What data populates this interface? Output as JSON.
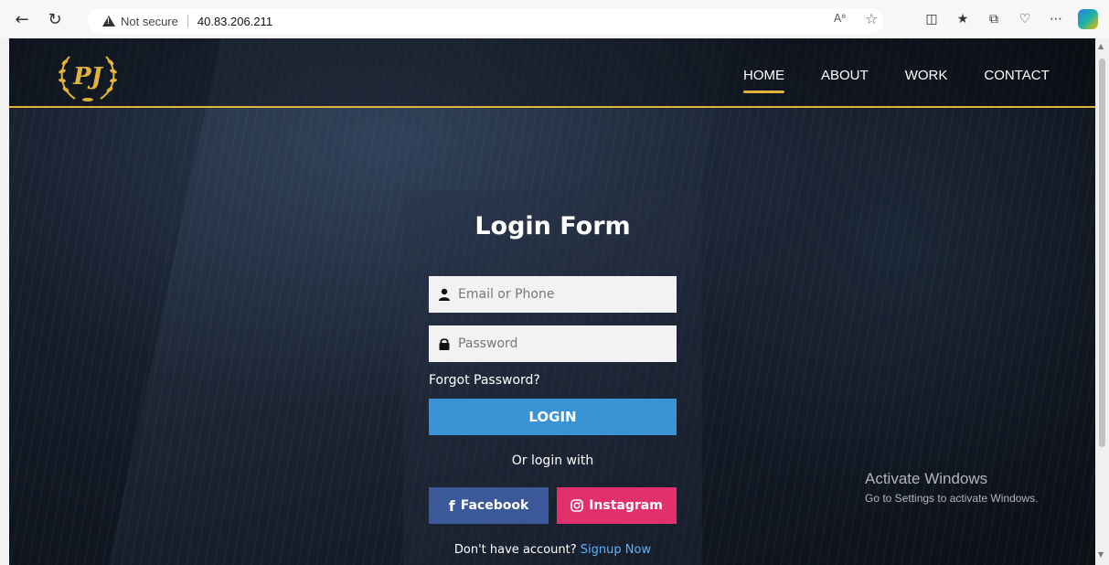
{
  "browser": {
    "security_label": "Not secure",
    "url": "40.83.206.211",
    "icons": [
      "back-icon",
      "reload-icon",
      "warning-icon",
      "read-aloud-icon",
      "favorite-icon",
      "split-screen-icon",
      "favorites-list-icon",
      "collections-icon",
      "browser-essentials-icon",
      "more-icon",
      "copilot-icon"
    ]
  },
  "site": {
    "logo_text": "PJ",
    "nav": {
      "home": "HOME",
      "about": "ABOUT",
      "work": "WORK",
      "contact": "CONTACT"
    }
  },
  "login": {
    "title": "Login Form",
    "email_placeholder": "Email or Phone",
    "password_placeholder": "Password",
    "forgot": "Forgot Password?",
    "login_button": "LOGIN",
    "or_login": "Or login with",
    "facebook": "Facebook",
    "instagram": "Instagram",
    "no_account": "Don't have account?",
    "signup": "Signup Now"
  },
  "overlay": {
    "activate_title": "Activate Windows",
    "activate_sub": "Go to Settings to activate Windows."
  },
  "colors": {
    "accent_gold": "#e0b43a",
    "login_blue": "#3a93d4",
    "facebook_blue": "#3b5998",
    "instagram_pink": "#e1306c",
    "signup_link": "#59b2ff"
  }
}
